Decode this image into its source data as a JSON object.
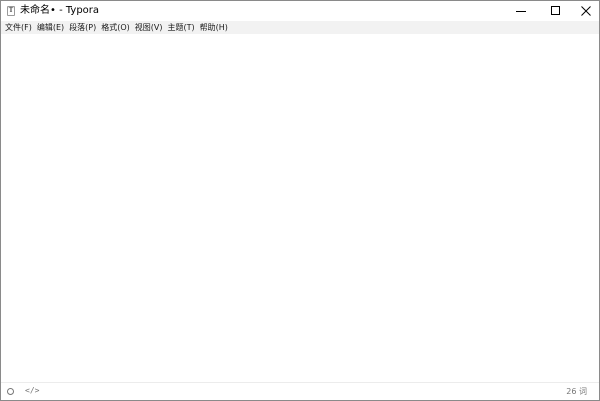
{
  "window": {
    "title": "未命名• - Typora",
    "app_icon_glyph": "T"
  },
  "menubar": {
    "items": [
      {
        "label": "文件(F)"
      },
      {
        "label": "编辑(E)"
      },
      {
        "label": "段落(P)"
      },
      {
        "label": "格式(O)"
      },
      {
        "label": "视图(V)"
      },
      {
        "label": "主题(T)"
      },
      {
        "label": "帮助(H)"
      }
    ]
  },
  "statusbar": {
    "sidebar_toggle_icon": "circle-outline-icon",
    "source_toggle_glyph": "</>",
    "word_count": "26 词"
  },
  "colors": {
    "menubar_bg": "#f2f2f2",
    "editor_bg": "#ffffff",
    "status_text": "#777777"
  }
}
